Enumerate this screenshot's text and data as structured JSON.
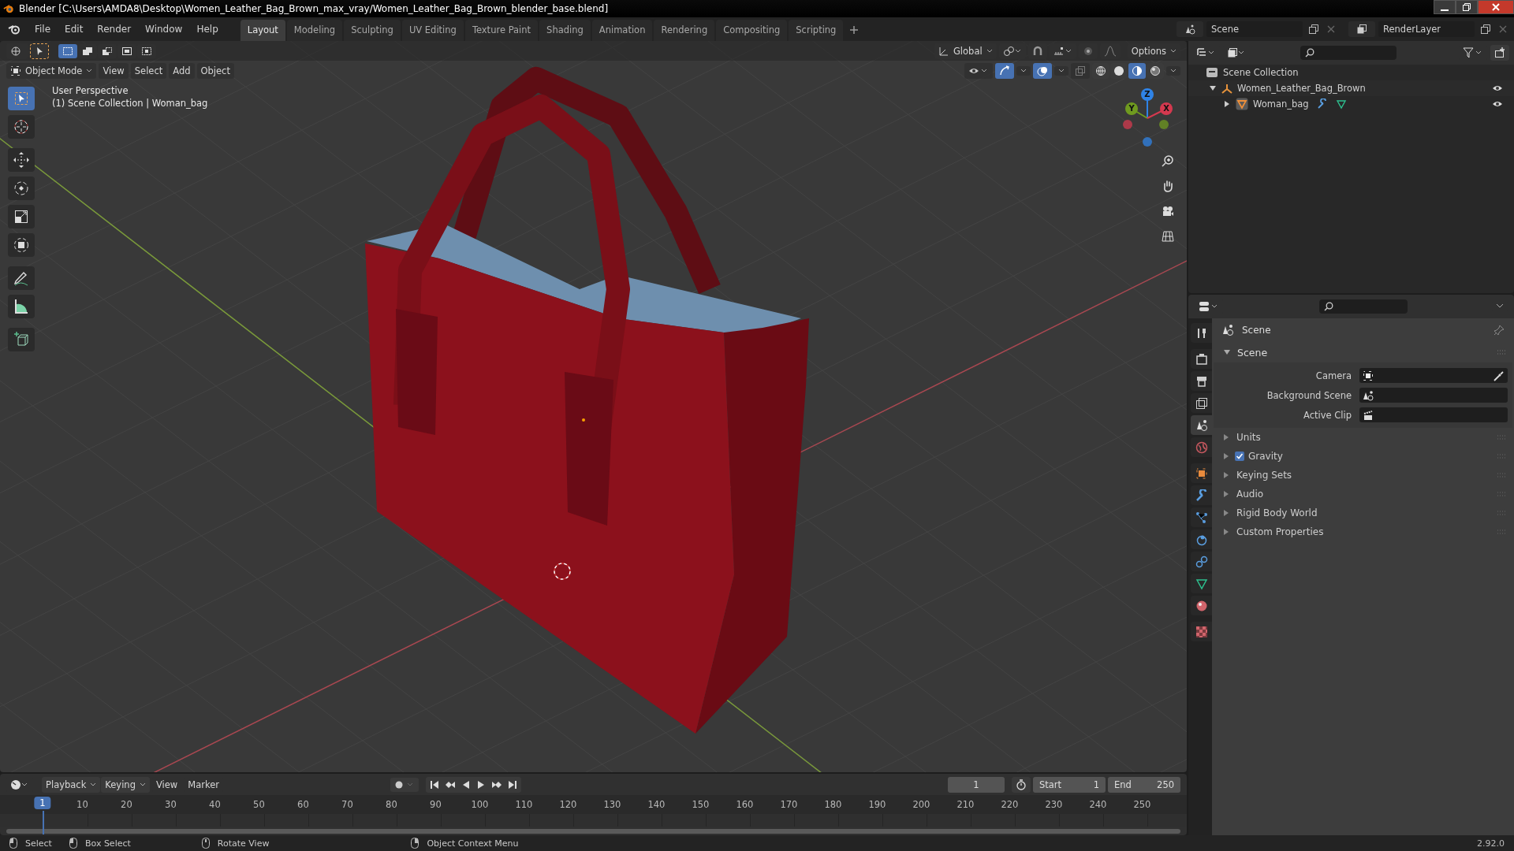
{
  "title_bar": {
    "title": "Blender [C:\\Users\\AMDA8\\Desktop\\Women_Leather_Bag_Brown_max_vray/Women_Leather_Bag_Brown_blender_base.blend]"
  },
  "menu": [
    "File",
    "Edit",
    "Render",
    "Window",
    "Help"
  ],
  "workspaces": [
    {
      "label": "Layout",
      "selected": true
    },
    {
      "label": "Modeling",
      "selected": false
    },
    {
      "label": "Sculpting",
      "selected": false
    },
    {
      "label": "UV Editing",
      "selected": false
    },
    {
      "label": "Texture Paint",
      "selected": false
    },
    {
      "label": "Shading",
      "selected": false
    },
    {
      "label": "Animation",
      "selected": false
    },
    {
      "label": "Rendering",
      "selected": false
    },
    {
      "label": "Compositing",
      "selected": false
    },
    {
      "label": "Scripting",
      "selected": false
    }
  ],
  "scene_selector": {
    "value": "Scene"
  },
  "view_layer_selector": {
    "value": "RenderLayer"
  },
  "viewport": {
    "orientation": "Global",
    "options": "Options",
    "mode": "Object Mode",
    "menus": [
      "View",
      "Select",
      "Add",
      "Object"
    ],
    "info": [
      "User Perspective",
      "(1) Scene Collection | Woman_bag"
    ],
    "tools": [
      {
        "kind": "select",
        "selected": true
      },
      {
        "kind": "cursor",
        "selected": false
      },
      {
        "kind": "move",
        "selected": false
      },
      {
        "kind": "rotate",
        "selected": false
      },
      {
        "kind": "scale",
        "selected": false
      },
      {
        "kind": "transform",
        "selected": false
      },
      {
        "kind": "annotate",
        "selected": false
      },
      {
        "kind": "measure",
        "selected": false
      },
      {
        "kind": "add-cube",
        "selected": false
      }
    ],
    "shading": [
      {
        "kind": "wireframe",
        "selected": false
      },
      {
        "kind": "solid",
        "selected": false
      },
      {
        "kind": "material",
        "selected": true
      },
      {
        "kind": "rendered",
        "selected": false
      }
    ],
    "gizmo_axes": [
      {
        "label": "Z",
        "color": "#2f83e6"
      },
      {
        "label": "Y",
        "color": "#6f9a1f"
      },
      {
        "label": "X",
        "color": "#d4394f"
      }
    ]
  },
  "outliner": {
    "root": "Scene Collection",
    "items": [
      {
        "label": "Women_Leather_Bag_Brown",
        "expanded": true,
        "children": [
          {
            "label": "Woman_bag",
            "expanded": false
          }
        ]
      }
    ]
  },
  "properties": {
    "tabs": [
      {
        "kind": "tool",
        "selected": false
      },
      {
        "kind": "render",
        "selected": false
      },
      {
        "kind": "output",
        "selected": false
      },
      {
        "kind": "view-layer",
        "selected": false
      },
      {
        "kind": "scene",
        "selected": true
      },
      {
        "kind": "world",
        "selected": false
      },
      {
        "kind": "object",
        "selected": false
      },
      {
        "kind": "modifiers",
        "selected": false
      },
      {
        "kind": "particles",
        "selected": false
      },
      {
        "kind": "physics",
        "selected": false
      },
      {
        "kind": "constraints",
        "selected": false
      },
      {
        "kind": "data",
        "selected": false
      },
      {
        "kind": "material",
        "selected": false
      },
      {
        "kind": "texture",
        "selected": false
      }
    ],
    "title": "Scene",
    "panel": {
      "title": "Scene",
      "expanded": true,
      "fields": [
        {
          "label": "Camera",
          "kind": "camera"
        },
        {
          "label": "Background Scene",
          "kind": "scene"
        },
        {
          "label": "Active Clip",
          "kind": "clip"
        }
      ]
    },
    "sections": [
      {
        "label": "Units",
        "kind": "plain"
      },
      {
        "label": "Gravity",
        "kind": "checkbox",
        "checked": true
      },
      {
        "label": "Keying Sets",
        "kind": "plain"
      },
      {
        "label": "Audio",
        "kind": "plain"
      },
      {
        "label": "Rigid Body World",
        "kind": "plain"
      },
      {
        "label": "Custom Properties",
        "kind": "plain"
      }
    ]
  },
  "timeline": {
    "menus": [
      "Playback",
      "Keying",
      "View",
      "Marker"
    ],
    "current_frame": "1",
    "start_label": "Start",
    "start": "1",
    "end_label": "End",
    "end": "250",
    "playhead": "1",
    "ticks": [
      "10",
      "20",
      "30",
      "40",
      "50",
      "60",
      "70",
      "80",
      "90",
      "100",
      "110",
      "120",
      "130",
      "140",
      "150",
      "160",
      "170",
      "180",
      "190",
      "200",
      "210",
      "220",
      "230",
      "240",
      "250"
    ]
  },
  "status_bar": {
    "hints": [
      "Select",
      "Box Select",
      "Rotate View",
      "Object Context Menu"
    ],
    "version": "2.92.0"
  }
}
